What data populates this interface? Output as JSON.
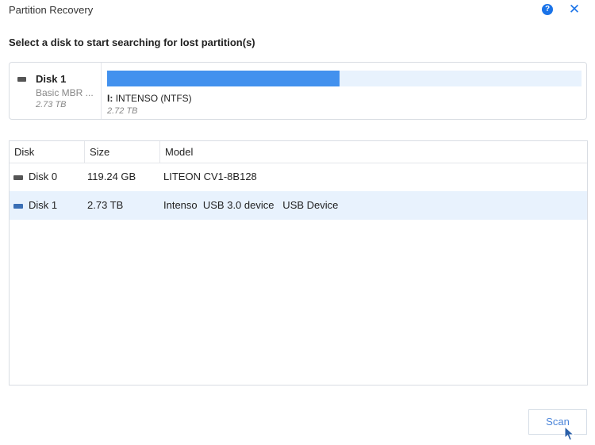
{
  "window": {
    "title": "Partition Recovery"
  },
  "header": {
    "prompt": "Select a disk to start searching for lost partition(s)"
  },
  "selected_disk": {
    "name": "Disk 1",
    "type": "Basic MBR ...",
    "size": "2.73 TB",
    "partition": {
      "letter": "I:",
      "label": "INTENSO (NTFS)",
      "size": "2.72 TB",
      "fill_fraction": 0.49
    }
  },
  "table": {
    "columns": [
      "Disk",
      "Size",
      "Model"
    ],
    "rows": [
      {
        "disk": "Disk 0",
        "size": "119.24 GB",
        "model": "LITEON CV1-8B128"
      },
      {
        "disk": "Disk 1",
        "size": "2.73 TB",
        "model": "Intenso  USB 3.0 device   USB Device"
      }
    ]
  },
  "footer": {
    "scan_label": "Scan"
  },
  "colors": {
    "accent": "#1a73e8",
    "bar": "#4291ee",
    "selection": "#e8f2fd"
  }
}
